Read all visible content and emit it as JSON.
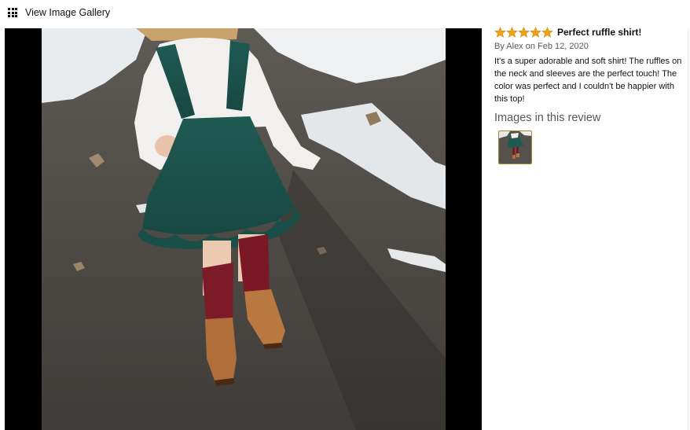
{
  "header": {
    "gallery_link_label": "View Image Gallery",
    "gallery_icon": "grid-icon"
  },
  "review": {
    "rating": 5,
    "rating_max": 5,
    "star_color": "#f0a21b",
    "title": "Perfect ruffle shirt!",
    "byline": "By Alex on Feb 12, 2020",
    "body": "It's a super adorable and soft shirt! The ruffles on the neck and sleeves are the perfect touch! The color was perfect and I couldn't be happier with this top!",
    "images_heading": "Images in this review",
    "thumbnails": [
      {
        "icon": "review-photo-thumbnail",
        "selected": true
      }
    ]
  },
  "viewer": {
    "image_description_icon": "review-photo-main",
    "letterbox_color": "#000000"
  }
}
